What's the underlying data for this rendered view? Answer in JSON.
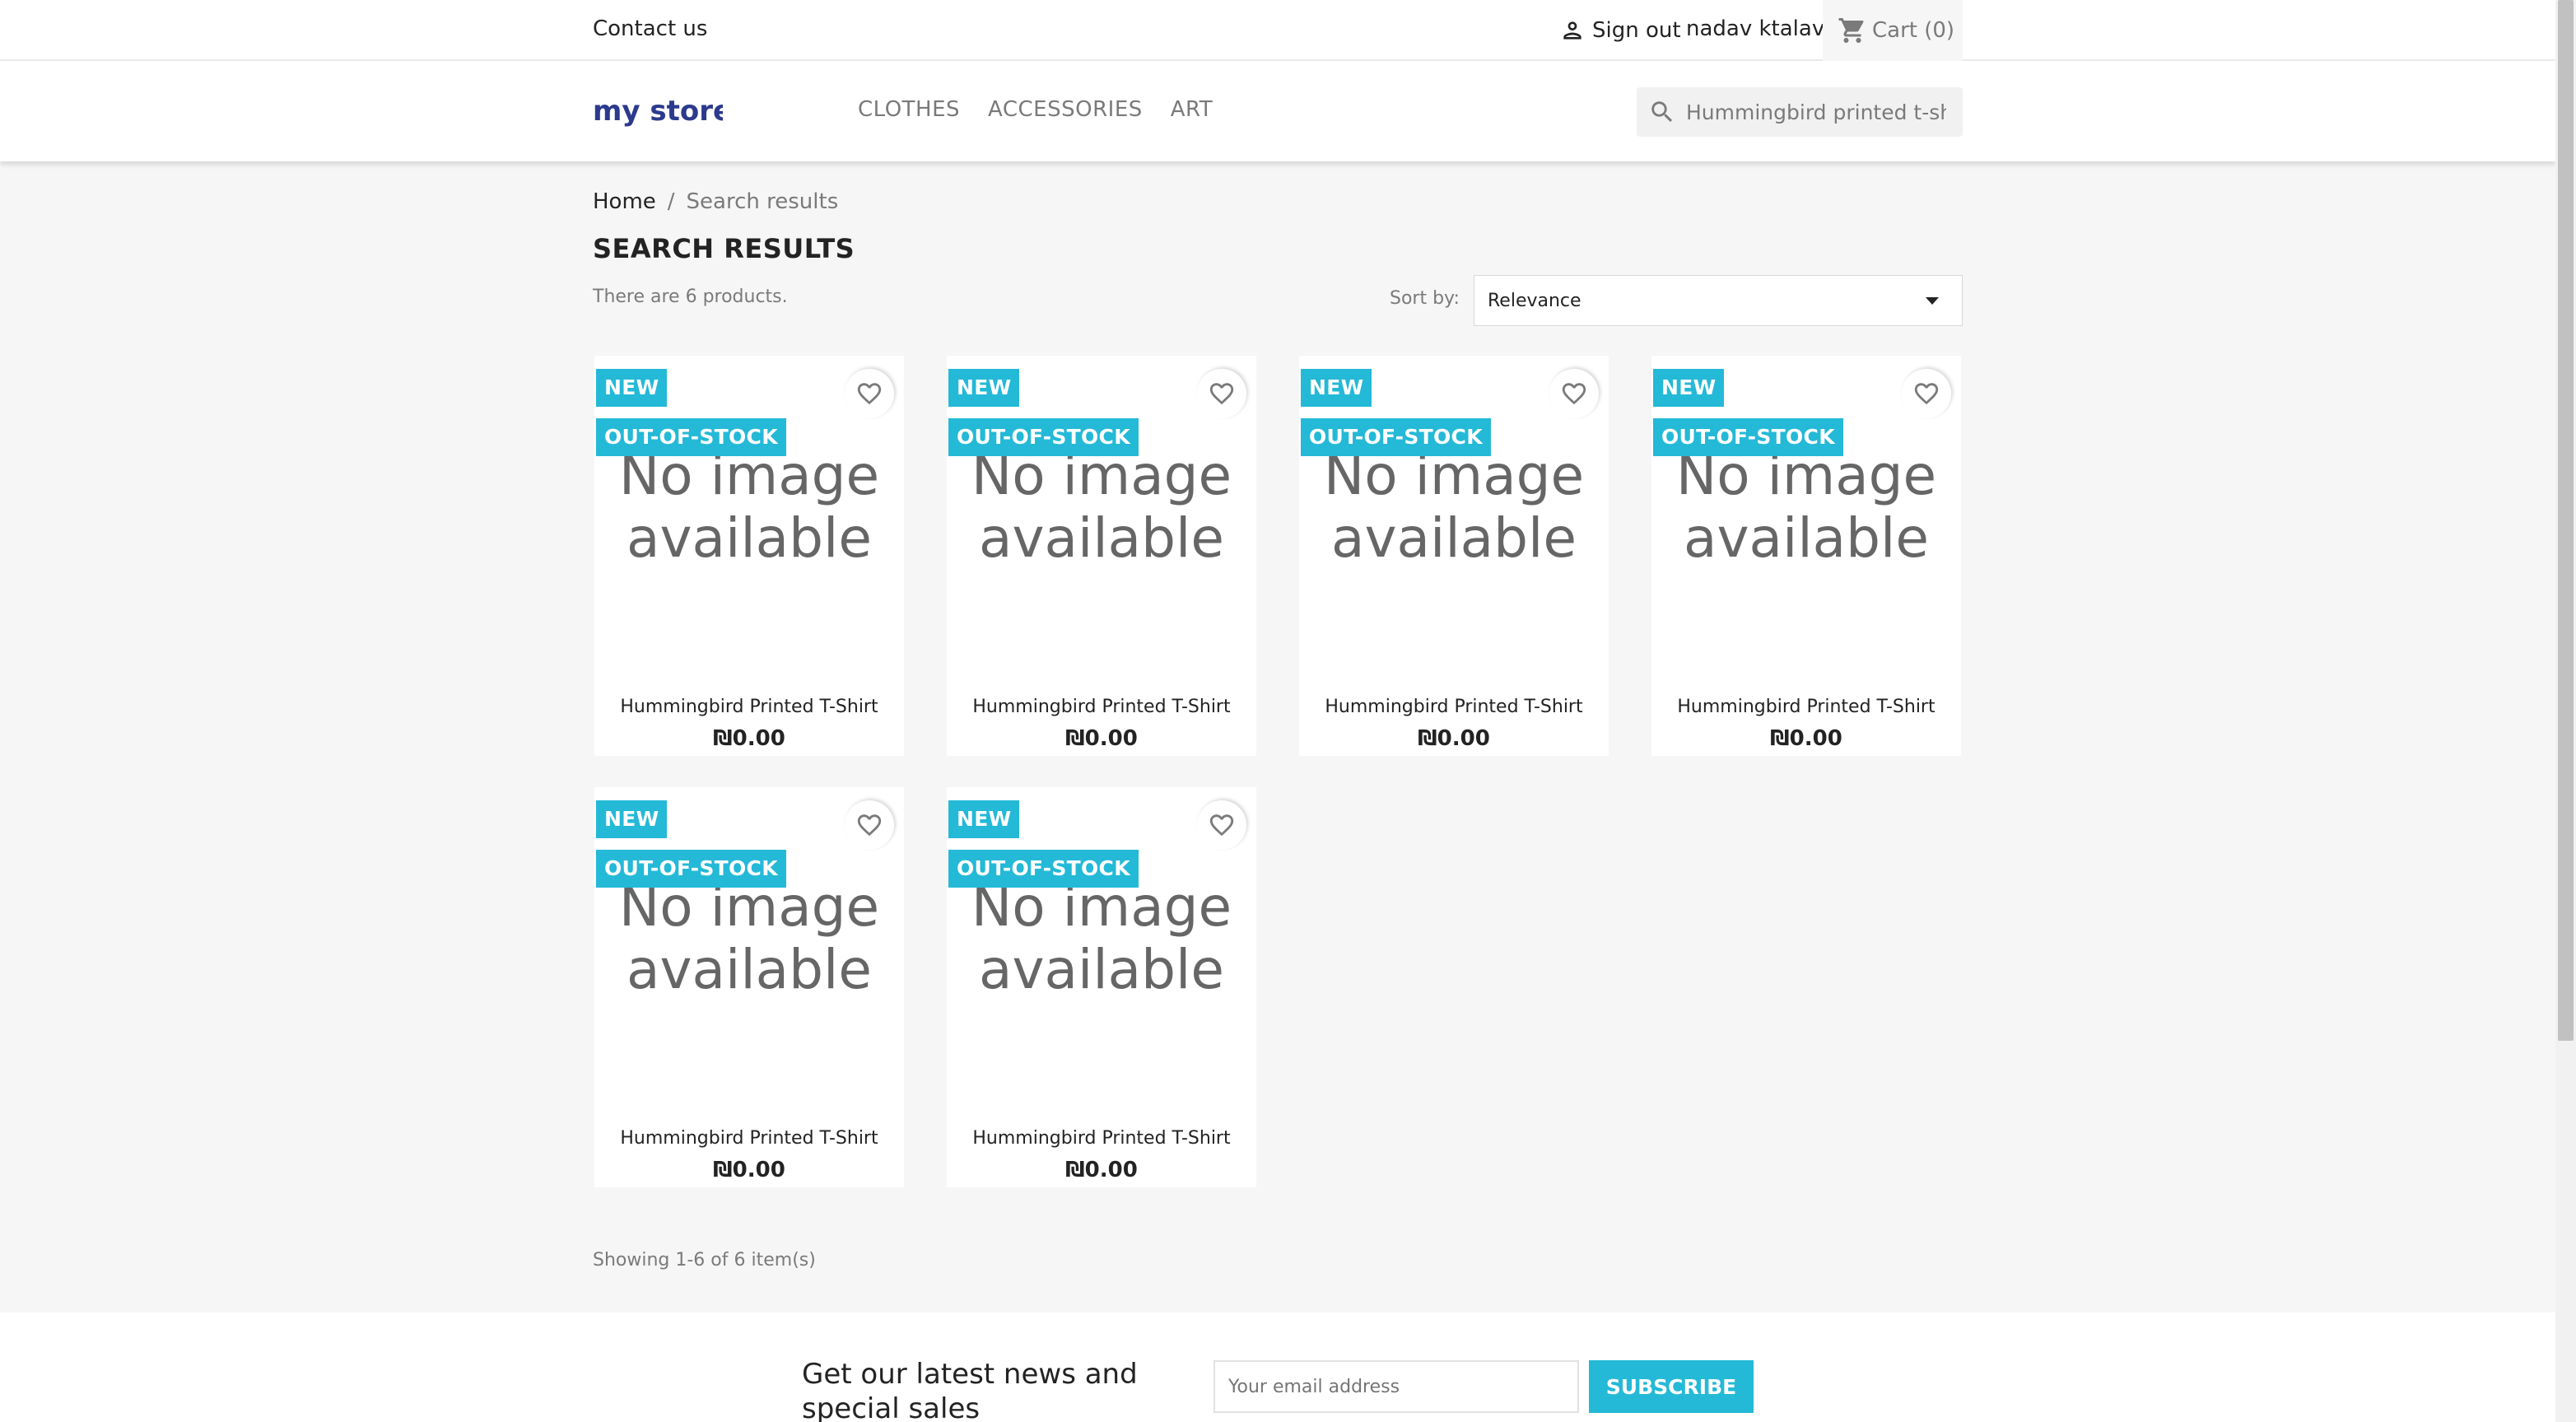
{
  "topbar": {
    "contact": "Contact us",
    "signout": "Sign out",
    "username": "nadav ktalav",
    "cart": "Cart (0)"
  },
  "header": {
    "logo_text": "my store",
    "nav": [
      "CLOTHES",
      "ACCESSORIES",
      "ART"
    ],
    "search_value": "Hummingbird printed t-shirt"
  },
  "breadcrumb": {
    "home": "Home",
    "separator": "/",
    "current": "Search results"
  },
  "listing": {
    "title": "SEARCH RESULTS",
    "count": "There are 6 products.",
    "sort_label": "Sort by:",
    "sort_value": "Relevance",
    "showing": "Showing 1-6 of 6 item(s)"
  },
  "products": [
    {
      "name": "Hummingbird Printed T-Shirt",
      "price": "₪0.00",
      "badge_new": "NEW",
      "badge_stock": "OUT-OF-STOCK",
      "image_text": "No image available"
    },
    {
      "name": "Hummingbird Printed T-Shirt",
      "price": "₪0.00",
      "badge_new": "NEW",
      "badge_stock": "OUT-OF-STOCK",
      "image_text": "No image available"
    },
    {
      "name": "Hummingbird Printed T-Shirt",
      "price": "₪0.00",
      "badge_new": "NEW",
      "badge_stock": "OUT-OF-STOCK",
      "image_text": "No image available"
    },
    {
      "name": "Hummingbird Printed T-Shirt",
      "price": "₪0.00",
      "badge_new": "NEW",
      "badge_stock": "OUT-OF-STOCK",
      "image_text": "No image available"
    },
    {
      "name": "Hummingbird Printed T-Shirt",
      "price": "₪0.00",
      "badge_new": "NEW",
      "badge_stock": "OUT-OF-STOCK",
      "image_text": "No image available"
    },
    {
      "name": "Hummingbird Printed T-Shirt",
      "price": "₪0.00",
      "badge_new": "NEW",
      "badge_stock": "OUT-OF-STOCK",
      "image_text": "No image available"
    }
  ],
  "footer": {
    "newsletter_title": "Get our latest news and special sales",
    "email_placeholder": "Your email address",
    "subscribe": "SUBSCRIBE"
  },
  "icons": {
    "user": "person-icon",
    "cart": "shopping-cart-icon",
    "search": "search-icon",
    "wishlist": "heart-outline-icon"
  },
  "colors": {
    "accent": "#24b9d7",
    "text": "#232323",
    "muted": "#7a7a7a",
    "background": "#f6f6f6"
  }
}
